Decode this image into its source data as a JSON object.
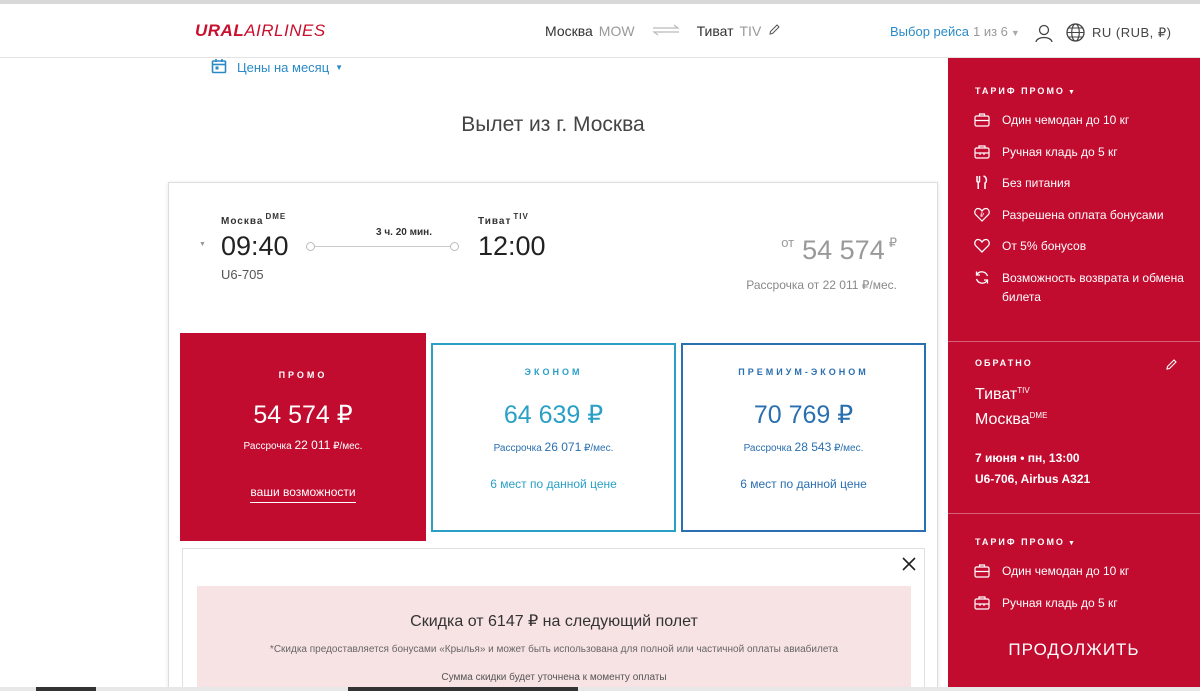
{
  "header": {
    "logo_part1": "URAL",
    "logo_part2": "AIRLINES",
    "origin_city": "Москва",
    "origin_code": "MOW",
    "dest_city": "Тиват",
    "dest_code": "TIV",
    "flight_select_label": "Выбор рейса",
    "flight_select_count": "1 из 6",
    "language": "RU (RUB, ₽)"
  },
  "month_prices": "Цены на месяц",
  "heading": "Вылет из г. Москва",
  "flight": {
    "dep_city": "Москва",
    "dep_code": "DME",
    "dep_time": "09:40",
    "flight_no": "U6-705",
    "duration": "3 ч. 20 мин.",
    "arr_city": "Тиват",
    "arr_code": "TIV",
    "arr_time": "12:00",
    "from_label": "от",
    "from_price": "54 574",
    "currency": "₽",
    "installment": "Рассрочка от 22 011 ₽/мес."
  },
  "tariffs": [
    {
      "name": "ПРОМО",
      "price": "54 574 ₽",
      "inst_prefix": "Рассрочка",
      "inst_value": "22 011",
      "inst_suffix": "₽/мес.",
      "more": "ваши возможности"
    },
    {
      "name": "ЭКОНОМ",
      "price": "64 639 ₽",
      "inst_prefix": "Рассрочка",
      "inst_value": "26 071",
      "inst_suffix": "₽/мес.",
      "seats": "6 мест по данной цене"
    },
    {
      "name": "ПРЕМИУМ-ЭКОНОМ",
      "price": "70 769 ₽",
      "inst_prefix": "Рассрочка",
      "inst_value": "28 543",
      "inst_suffix": "₽/мес.",
      "seats": "6 мест по данной цене"
    }
  ],
  "discount": {
    "title": "Скидка от 6147 ₽ на следующий полет",
    "note": "*Скидка предоставляется бонусами «Крылья» и может быть использована для полной или частичной оплаты авиабилета",
    "note2": "Сумма скидки будет уточнена к моменту оплаты"
  },
  "sidebar": {
    "tariff_title": "ТАРИФ ПРОМО",
    "features": [
      {
        "icon": "suitcase-icon",
        "label": "Один чемодан до 10 кг"
      },
      {
        "icon": "bag-icon",
        "label": "Ручная кладь до 5 кг"
      },
      {
        "icon": "cutlery-icon",
        "label": "Без питания"
      },
      {
        "icon": "bonus-pay-icon",
        "label": "Разрешена оплата бонусами"
      },
      {
        "icon": "heart-icon",
        "label": "От 5% бонусов"
      },
      {
        "icon": "refresh-icon",
        "label": "Возможность возврата и обмена билета"
      }
    ],
    "return_title": "ОБРАТНО",
    "return_from": "Тиват",
    "return_from_code": "TIV",
    "return_to": "Москва",
    "return_to_code": "DME",
    "return_date": "7 июня • пн, 13:00",
    "return_flight": "U6-706, Airbus A321",
    "tariff2_title": "ТАРИФ ПРОМО",
    "features2": [
      {
        "icon": "suitcase-icon",
        "label": "Один чемодан до 10 кг"
      },
      {
        "icon": "bag-icon",
        "label": "Ручная кладь до 5 кг"
      }
    ],
    "continue": "ПРОДОЛЖИТЬ"
  }
}
